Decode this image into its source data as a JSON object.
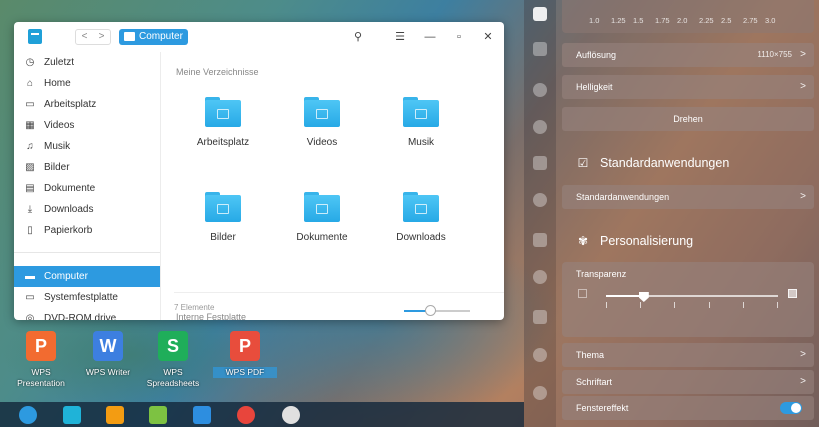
{
  "file_manager": {
    "breadcrumb": "Computer",
    "nav_back": "<",
    "nav_forward": ">",
    "sidebar": [
      {
        "label": "Zuletzt",
        "icon": "clock-icon",
        "glyph": "◷"
      },
      {
        "label": "Home",
        "icon": "home-icon",
        "glyph": "⌂"
      },
      {
        "label": "Arbeitsplatz",
        "icon": "desktop-icon",
        "glyph": "▭"
      },
      {
        "label": "Videos",
        "icon": "video-icon",
        "glyph": "▦"
      },
      {
        "label": "Musik",
        "icon": "music-icon",
        "glyph": "♫"
      },
      {
        "label": "Bilder",
        "icon": "image-icon",
        "glyph": "▨"
      },
      {
        "label": "Dokumente",
        "icon": "document-icon",
        "glyph": "▤"
      },
      {
        "label": "Downloads",
        "icon": "download-icon",
        "glyph": "⤓"
      },
      {
        "label": "Papierkorb",
        "icon": "trash-icon",
        "glyph": "▯"
      },
      {
        "label": "Computer",
        "icon": "computer-icon",
        "glyph": "▬"
      },
      {
        "label": "Systemfestplatte",
        "icon": "disk-icon",
        "glyph": "▭"
      },
      {
        "label": "DVD-ROM drive",
        "icon": "dvd-icon",
        "glyph": "◎"
      }
    ],
    "section_my_dirs": "Meine Verzeichnisse",
    "folders": [
      "Arbeitsplatz",
      "Videos",
      "Musik",
      "Bilder",
      "Dokumente",
      "Downloads"
    ],
    "section_internal": "Interne Festplatte",
    "status": "7 Elemente",
    "zoom_level": 0.4
  },
  "desktop_icons": [
    {
      "label": "WPS Presentation",
      "color": "#f26b30",
      "glyph": "P"
    },
    {
      "label": "WPS Writer",
      "color": "#3d7fe0",
      "glyph": "W"
    },
    {
      "label": "WPS Spreadsheets",
      "color": "#1fae5a",
      "glyph": "S"
    },
    {
      "label": "WPS PDF",
      "color": "#e84d3c",
      "glyph": "P"
    }
  ],
  "dock": [
    {
      "icon": "launcher-icon",
      "color": "#2d9ae0"
    },
    {
      "icon": "file-manager-icon",
      "color": "#1fb3d8"
    },
    {
      "icon": "store-icon",
      "color": "#f39c12"
    },
    {
      "icon": "image-viewer-icon",
      "color": "#7dc242"
    },
    {
      "icon": "video-player-icon",
      "color": "#2d8ee0"
    },
    {
      "icon": "chrome-icon",
      "color": "#e8453c"
    },
    {
      "icon": "settings-icon",
      "color": "#e0e0e0"
    }
  ],
  "control_center": {
    "scale_values": [
      "1.0",
      "1.25",
      "1.5",
      "1.75",
      "2.0",
      "2.25",
      "2.5",
      "2.75",
      "3.0"
    ],
    "resolution_label": "Auflösung",
    "resolution_value": "1110×755",
    "brightness_label": "Helligkeit",
    "rotate_label": "Drehen",
    "default_apps_title": "Standardanwendungen",
    "default_apps_row": "Standardanwendungen",
    "personalization_title": "Personalisierung",
    "transparency_label": "Transparenz",
    "transparency_value": 0.22,
    "theme_label": "Thema",
    "font_label": "Schriftart",
    "window_effect_label": "Fenstereffekt",
    "window_effect_on": true,
    "chevron": ">"
  }
}
